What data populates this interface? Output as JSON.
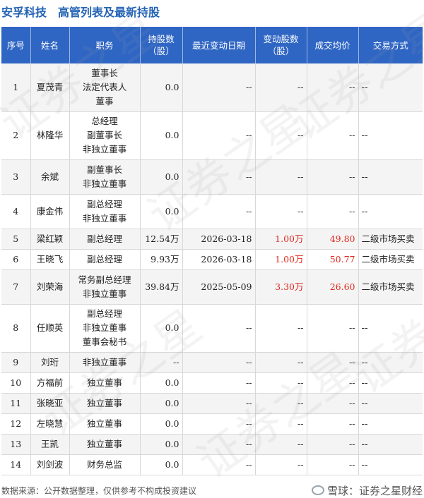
{
  "header": {
    "company": "安孚科技",
    "title": "高管列表及最新持股"
  },
  "columns": [
    "序号",
    "姓名",
    "职务",
    "持股数\n（股）",
    "最近变动日期",
    "变动股数\n（股）",
    "成交均价",
    "交易方式"
  ],
  "rows": [
    {
      "idx": "1",
      "name": "夏茂青",
      "position": [
        "董事长",
        "法定代表人",
        "董事"
      ],
      "shares": "0.0",
      "date": "--",
      "change": "--",
      "price": "--",
      "mode": "--",
      "highlight": false
    },
    {
      "idx": "2",
      "name": "林隆华",
      "position": [
        "总经理",
        "副董事长",
        "非独立董事"
      ],
      "shares": "0.0",
      "date": "--",
      "change": "--",
      "price": "--",
      "mode": "--",
      "highlight": false
    },
    {
      "idx": "3",
      "name": "余斌",
      "position": [
        "副董事长",
        "非独立董事"
      ],
      "shares": "0.0",
      "date": "--",
      "change": "--",
      "price": "--",
      "mode": "--",
      "highlight": false
    },
    {
      "idx": "4",
      "name": "康金伟",
      "position": [
        "副总经理",
        "非独立董事"
      ],
      "shares": "0.0",
      "date": "--",
      "change": "--",
      "price": "--",
      "mode": "--",
      "highlight": false
    },
    {
      "idx": "5",
      "name": "梁红颖",
      "position": [
        "副总经理"
      ],
      "shares": "12.54万",
      "date": "2026-03-18",
      "change": "1.00万",
      "price": "49.80",
      "mode": "二级市场买卖",
      "highlight": true
    },
    {
      "idx": "6",
      "name": "王晓飞",
      "position": [
        "副总经理"
      ],
      "shares": "9.93万",
      "date": "2026-03-18",
      "change": "1.00万",
      "price": "50.77",
      "mode": "二级市场买卖",
      "highlight": true
    },
    {
      "idx": "7",
      "name": "刘荣海",
      "position": [
        "常务副总经理",
        "非独立董事"
      ],
      "shares": "39.84万",
      "date": "2025-05-09",
      "change": "3.30万",
      "price": "26.60",
      "mode": "二级市场买卖",
      "highlight": true
    },
    {
      "idx": "8",
      "name": "任顺英",
      "position": [
        "副总经理",
        "非独立董事",
        "董事会秘书"
      ],
      "shares": "0.0",
      "date": "--",
      "change": "--",
      "price": "--",
      "mode": "--",
      "highlight": false
    },
    {
      "idx": "9",
      "name": "刘珩",
      "position": [
        "非独立董事"
      ],
      "shares": "--",
      "date": "--",
      "change": "--",
      "price": "--",
      "mode": "--",
      "highlight": false
    },
    {
      "idx": "10",
      "name": "方福前",
      "position": [
        "独立董事"
      ],
      "shares": "0.0",
      "date": "--",
      "change": "--",
      "price": "--",
      "mode": "--",
      "highlight": false
    },
    {
      "idx": "11",
      "name": "张晓亚",
      "position": [
        "独立董事"
      ],
      "shares": "0.0",
      "date": "--",
      "change": "--",
      "price": "--",
      "mode": "--",
      "highlight": false
    },
    {
      "idx": "12",
      "name": "左晓慧",
      "position": [
        "独立董事"
      ],
      "shares": "0.0",
      "date": "--",
      "change": "--",
      "price": "--",
      "mode": "--",
      "highlight": false
    },
    {
      "idx": "13",
      "name": "王凯",
      "position": [
        "独立董事"
      ],
      "shares": "0.0",
      "date": "--",
      "change": "--",
      "price": "--",
      "mode": "--",
      "highlight": false
    },
    {
      "idx": "14",
      "name": "刘剑波",
      "position": [
        "财务总监"
      ],
      "shares": "0.0",
      "date": "--",
      "change": "--",
      "price": "--",
      "mode": "--",
      "highlight": false
    }
  ],
  "footer": {
    "source": "数据来源：公开数据整理，仅供参考不构成投资建议",
    "brand": "雪球：证券之星财经"
  },
  "watermark_text": "证券之星",
  "colors": {
    "header_bg": "#2f66c4",
    "title": "#2463b5",
    "highlight": "#e0281e"
  }
}
